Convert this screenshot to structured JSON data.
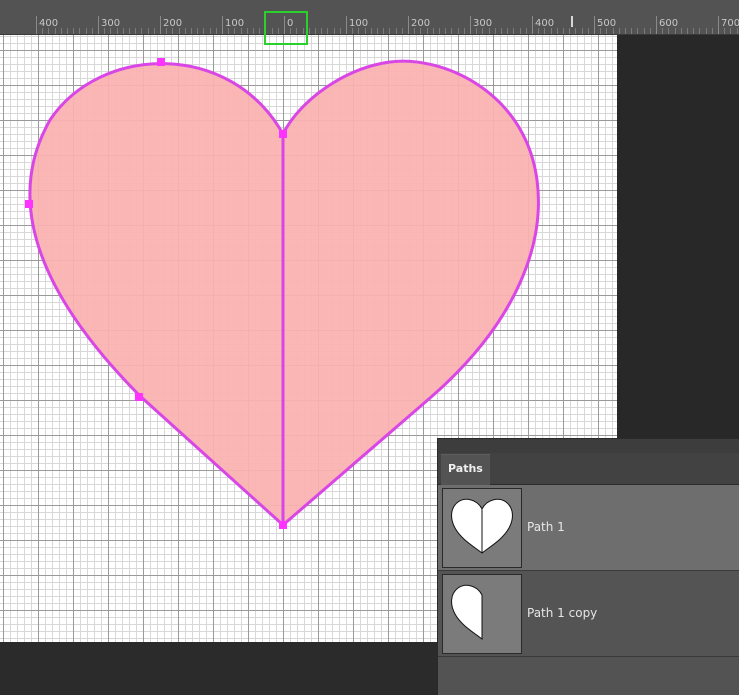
{
  "ruler": {
    "labels": [
      "400",
      "300",
      "200",
      "100",
      "0",
      "100",
      "200",
      "300",
      "400",
      "500",
      "600",
      "700"
    ]
  },
  "colors": {
    "heart_fill": "#fbb0b0",
    "path_stroke": "#d946e6",
    "anchor": "#ff33ff",
    "highlight": "#2bd12b",
    "panel_bg": "#535353"
  },
  "panel": {
    "tab_label": "Paths",
    "items": [
      {
        "name": "Path 1",
        "thumbnail": "full-heart-icon",
        "selected": true
      },
      {
        "name": "Path 1 copy",
        "thumbnail": "half-heart-icon",
        "selected": false
      }
    ]
  }
}
